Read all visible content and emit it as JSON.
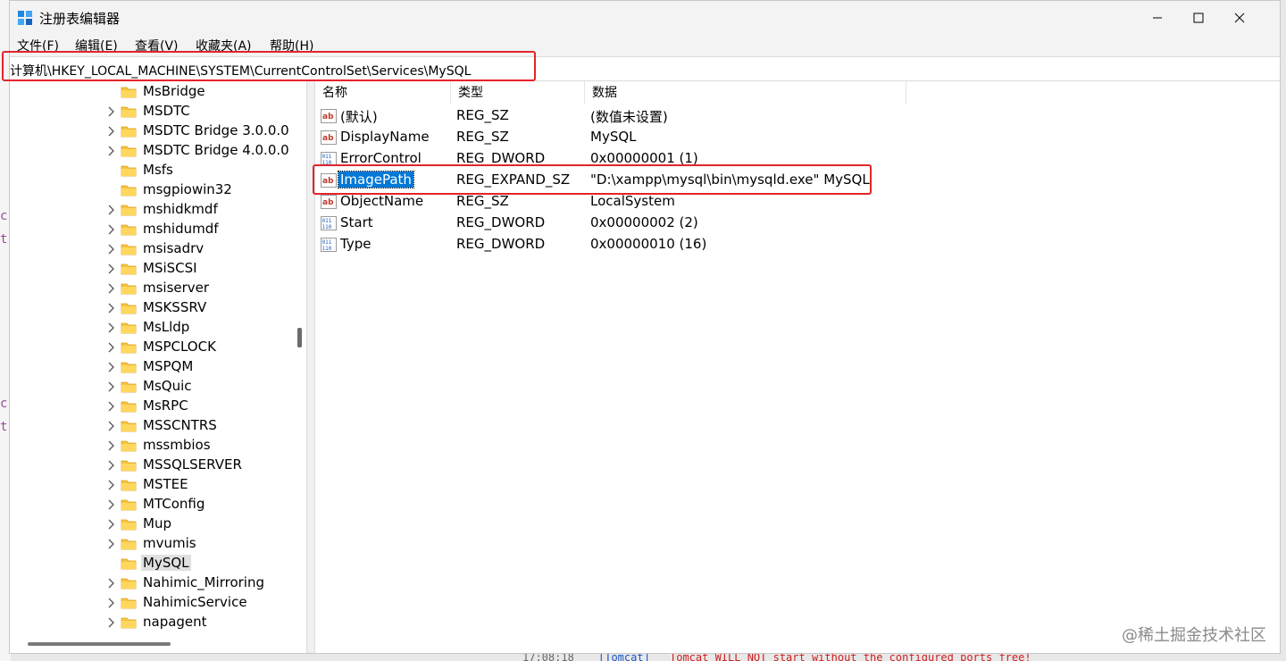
{
  "window": {
    "title": "注册表编辑器"
  },
  "menu": [
    "文件(F)",
    "编辑(E)",
    "查看(V)",
    "收藏夹(A)",
    "帮助(H)"
  ],
  "address": "计算机\\HKEY_LOCAL_MACHINE\\SYSTEM\\CurrentControlSet\\Services\\MySQL",
  "tree": [
    {
      "label": "MsBridge",
      "expandable": false
    },
    {
      "label": "MSDTC",
      "expandable": true
    },
    {
      "label": "MSDTC Bridge 3.0.0.0",
      "expandable": true
    },
    {
      "label": "MSDTC Bridge 4.0.0.0",
      "expandable": true
    },
    {
      "label": "Msfs",
      "expandable": false
    },
    {
      "label": "msgpiowin32",
      "expandable": false
    },
    {
      "label": "mshidkmdf",
      "expandable": true
    },
    {
      "label": "mshidumdf",
      "expandable": true
    },
    {
      "label": "msisadrv",
      "expandable": true
    },
    {
      "label": "MSiSCSI",
      "expandable": true
    },
    {
      "label": "msiserver",
      "expandable": true
    },
    {
      "label": "MSKSSRV",
      "expandable": true
    },
    {
      "label": "MsLldp",
      "expandable": true
    },
    {
      "label": "MSPCLOCK",
      "expandable": true
    },
    {
      "label": "MSPQM",
      "expandable": true
    },
    {
      "label": "MsQuic",
      "expandable": true
    },
    {
      "label": "MsRPC",
      "expandable": true
    },
    {
      "label": "MSSCNTRS",
      "expandable": true
    },
    {
      "label": "mssmbios",
      "expandable": true
    },
    {
      "label": "MSSQLSERVER",
      "expandable": true
    },
    {
      "label": "MSTEE",
      "expandable": true
    },
    {
      "label": "MTConfig",
      "expandable": true
    },
    {
      "label": "Mup",
      "expandable": true
    },
    {
      "label": "mvumis",
      "expandable": true
    },
    {
      "label": "MySQL",
      "expandable": false,
      "selected": true
    },
    {
      "label": "Nahimic_Mirroring",
      "expandable": true
    },
    {
      "label": "NahimicService",
      "expandable": true
    },
    {
      "label": "napagent",
      "expandable": true
    }
  ],
  "columns": [
    "名称",
    "类型",
    "数据"
  ],
  "values": [
    {
      "name": "(默认)",
      "type": "REG_SZ",
      "data": "(数值未设置)",
      "icon": "string-value-icon"
    },
    {
      "name": "DisplayName",
      "type": "REG_SZ",
      "data": "MySQL",
      "icon": "string-value-icon"
    },
    {
      "name": "ErrorControl",
      "type": "REG_DWORD",
      "data": "0x00000001 (1)",
      "icon": "dword-value-icon"
    },
    {
      "name": "ImagePath",
      "type": "REG_EXPAND_SZ",
      "data": "\"D:\\xampp\\mysql\\bin\\mysqld.exe\" MySQL",
      "icon": "string-value-icon",
      "selected": true
    },
    {
      "name": "ObjectName",
      "type": "REG_SZ",
      "data": "LocalSystem",
      "icon": "string-value-icon"
    },
    {
      "name": "Start",
      "type": "REG_DWORD",
      "data": "0x00000002 (2)",
      "icon": "dword-value-icon"
    },
    {
      "name": "Type",
      "type": "REG_DWORD",
      "data": "0x00000010 (16)",
      "icon": "dword-value-icon"
    }
  ],
  "background": {
    "console_time": "17:08:18",
    "console_tag": "[Tomcat]",
    "console_msg": "Tomcat WILL NOT start without the configured ports free!",
    "watermark": "@稀土掘金技术社区"
  },
  "colors": {
    "highlight_border": "#e3242b",
    "selection": "#0078d7",
    "folder": "#f6c343"
  }
}
